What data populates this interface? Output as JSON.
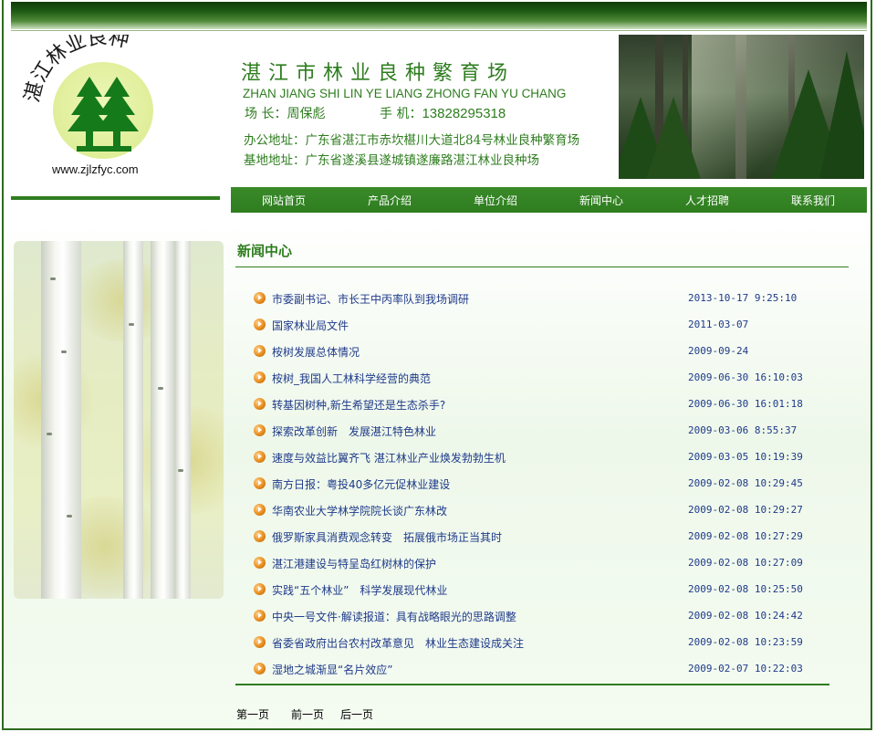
{
  "logo": {
    "arc_text": "湛江林业良种",
    "url": "www.zjlzfyc.com"
  },
  "company": {
    "name": "湛江市林业良种繁育场",
    "pinyin": "ZHAN JIANG SHI LIN YE LIANG ZHONG FAN YU CHANG",
    "director": "场 长：周保彪",
    "phone_label": "手 机：",
    "phone_value": "13828295318",
    "office_address": "办公地址：广东省湛江市赤坎椹川大道北84号林业良种繁育场",
    "base_address": "基地地址：广东省遂溪县遂城镇遂廉路湛江林业良种场"
  },
  "nav": {
    "items": [
      {
        "label": "网站首页"
      },
      {
        "label": "产品介绍"
      },
      {
        "label": "单位介绍"
      },
      {
        "label": "新闻中心"
      },
      {
        "label": "人才招聘"
      },
      {
        "label": "联系我们"
      }
    ]
  },
  "news": {
    "section_title": "新闻中心",
    "items": [
      {
        "title": "市委副书记、市长王中丙率队到我场调研",
        "date": "2013-10-17 9:25:10"
      },
      {
        "title": "国家林业局文件",
        "date": "2011-03-07"
      },
      {
        "title": "桉树发展总体情况",
        "date": "2009-09-24"
      },
      {
        "title": "桉树_我国人工林科学经营的典范",
        "date": "2009-06-30 16:10:03"
      },
      {
        "title": "转基因树种,新生希望还是生态杀手?",
        "date": "2009-06-30 16:01:18"
      },
      {
        "title": "探索改革创新　发展湛江特色林业",
        "date": "2009-03-06 8:55:37"
      },
      {
        "title": "速度与效益比翼齐飞 湛江林业产业焕发勃勃生机",
        "date": "2009-03-05 10:19:39"
      },
      {
        "title": "南方日报：粤投40多亿元促林业建设",
        "date": "2009-02-08 10:29:45"
      },
      {
        "title": "华南农业大学林学院院长谈广东林改",
        "date": "2009-02-08 10:29:27"
      },
      {
        "title": "俄罗斯家具消费观念转变　拓展俄市场正当其时",
        "date": "2009-02-08 10:27:29"
      },
      {
        "title": "湛江港建设与特呈岛红树林的保护",
        "date": "2009-02-08 10:27:09"
      },
      {
        "title": "实践“五个林业”　科学发展现代林业",
        "date": "2009-02-08 10:25:50"
      },
      {
        "title": "中央一号文件·解读报道：具有战略眼光的思路调整",
        "date": "2009-02-08 10:24:42"
      },
      {
        "title": "省委省政府出台农村改革意见　林业生态建设成关注",
        "date": "2009-02-08 10:23:59"
      },
      {
        "title": "湿地之城渐显“名片效应”",
        "date": "2009-02-07 10:22:03"
      }
    ]
  },
  "pager": {
    "first": "第一页",
    "prev": "前一页",
    "next": "后一页"
  },
  "colors": {
    "brand_green": "#2e7d1f",
    "link_blue": "#1e3a8a",
    "bullet_orange": "#e88d1c"
  },
  "icons": {
    "news_bullet": "orange-arrow-bullet-icon",
    "logo_tree": "pine-tree-icon"
  }
}
